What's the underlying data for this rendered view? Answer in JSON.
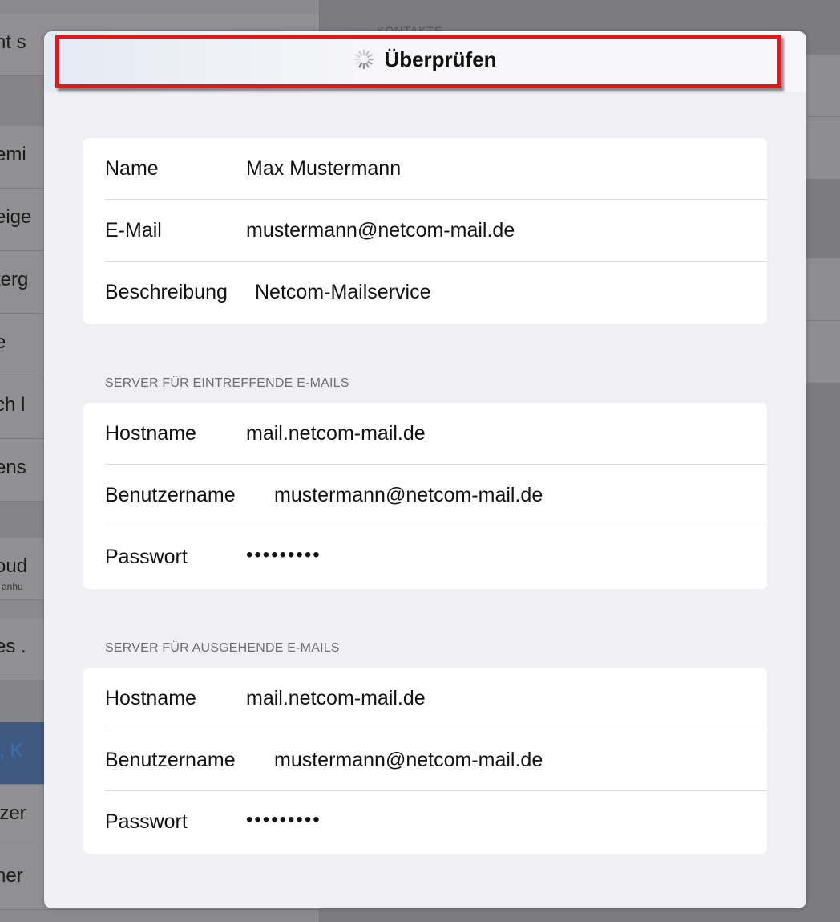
{
  "background": {
    "left_rows": [
      {
        "label": "ht s"
      },
      {
        "label": ""
      },
      {
        "label": "emi"
      },
      {
        "label": "eige"
      },
      {
        "label": "terg"
      },
      {
        "label": "e"
      },
      {
        "label": "ch l"
      },
      {
        "label": "ens"
      },
      {
        "label": ""
      },
      {
        "label": "oud",
        "sub": "anhu"
      },
      {
        "label": "es ."
      },
      {
        "label": ""
      },
      {
        "label": "l, K"
      },
      {
        "label": "izer"
      },
      {
        "label": "ner"
      }
    ],
    "right_header": "KONTAKTE"
  },
  "modal": {
    "title": "Überprüfen",
    "account": {
      "name_label": "Name",
      "name_value": "Max Mustermann",
      "email_label": "E-Mail",
      "email_value": "mustermann@netcom-mail.de",
      "description_label": "Beschreibung",
      "description_value": "Netcom-Mailservice"
    },
    "incoming": {
      "section_label": "SERVER FÜR EINTREFFENDE E-MAILS",
      "hostname_label": "Hostname",
      "hostname_value": "mail.netcom-mail.de",
      "username_label": "Benutzername",
      "username_value": "mustermann@netcom-mail.de",
      "password_label": "Passwort",
      "password_value": "•••••••••"
    },
    "outgoing": {
      "section_label": "SERVER FÜR AUSGEHENDE E-MAILS",
      "hostname_label": "Hostname",
      "hostname_value": "mail.netcom-mail.de",
      "username_label": "Benutzername",
      "username_value": "mustermann@netcom-mail.de",
      "password_label": "Passwort",
      "password_value": "•••••••••"
    }
  },
  "colors": {
    "highlight": "#e8141a",
    "selected_row": "#3f5a82"
  }
}
